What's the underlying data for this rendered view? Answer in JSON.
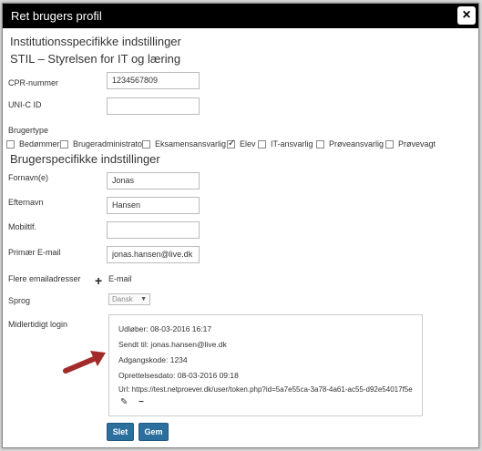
{
  "dialog": {
    "title": "Ret brugers profil",
    "close": "×"
  },
  "institution": {
    "heading": "Institutionsspecifikke indstillinger",
    "name": "STIL – Styrelsen for IT og læring",
    "cpr_label": "CPR-nummer",
    "cpr_value": "1234567809",
    "unic_label": "UNI-C ID",
    "unic_value": "",
    "usertype_label": "Brugertype",
    "usertypes": [
      {
        "label": "Bedømmer",
        "checked": false
      },
      {
        "label": "Brugeradministrator",
        "checked": false
      },
      {
        "label": "Eksamensansvarlig",
        "checked": false
      },
      {
        "label": "Elev",
        "checked": true
      },
      {
        "label": "IT-ansvarlig",
        "checked": false
      },
      {
        "label": "Prøveansvarlig",
        "checked": false
      },
      {
        "label": "Prøvevagt",
        "checked": false
      }
    ]
  },
  "user": {
    "heading": "Brugerspecifikke indstillinger",
    "firstname_label": "Fornavn(e)",
    "firstname_value": "Jonas",
    "lastname_label": "Efternavn",
    "lastname_value": "Hansen",
    "mobile_label": "Mobiltlf.",
    "mobile_value": "",
    "email_label": "Primær E-mail",
    "email_value": "jonas.hansen@live.dk",
    "extra_email_label": "Flere emailadresser",
    "extra_email_col": "E-mail",
    "language_label": "Sprog",
    "language_value": "Dansk",
    "templogin_label": "Midlertidigt login"
  },
  "templogin": {
    "expires": "Udløber: 08-03-2016 16:17",
    "sent_to": "Sendt til: jonas.hansen@live.dk",
    "password": "Adgangskode: 1234",
    "created": "Oprettelsesdato: 08-03-2016 09:18",
    "url": "Url: https://test.netproever.dk/user/token.php?id=5a7e55ca-3a78-4a61-ac55-d92e54017f5e"
  },
  "buttons": {
    "delete": "Slet",
    "save": "Gem"
  },
  "colors": {
    "titlebar": "#000000",
    "button": "#2a6f9e",
    "arrow": "#a32a2a"
  }
}
